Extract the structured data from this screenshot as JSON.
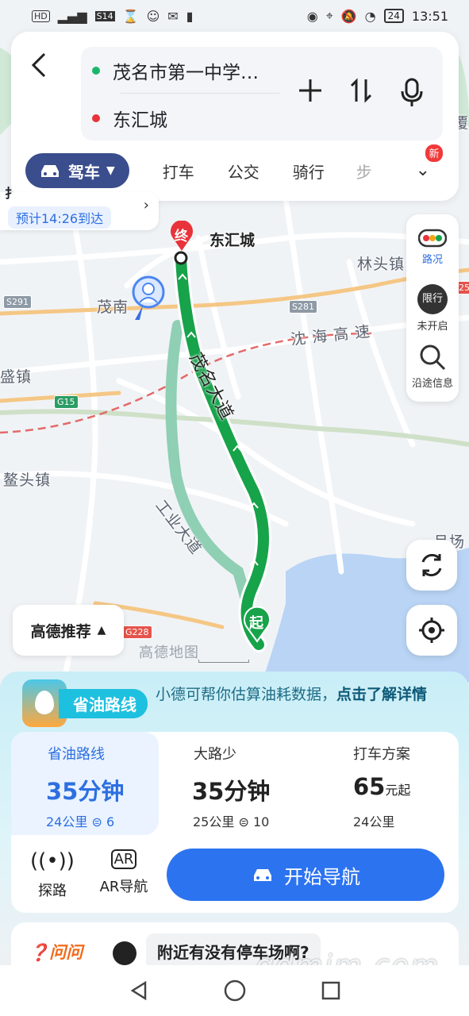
{
  "status_bar": {
    "left_icons": [
      "hd-icon",
      "4g-signal-icon",
      "s14-icon",
      "hourglass-icon",
      "profile-icon",
      "wechat-icon",
      "sim-icon"
    ],
    "network": "HD",
    "carrier_tag": "S14",
    "battery": "24",
    "time": "13:51"
  },
  "search": {
    "origin": "茂名市第一中学…",
    "destination": "东汇城",
    "origin_color": "#1bb66b",
    "destination_color": "#e8333a"
  },
  "mode_tabs": [
    {
      "label": "驾车",
      "active": true
    },
    {
      "label": "打车",
      "active": false
    },
    {
      "label": "公交",
      "active": false
    },
    {
      "label": "骑行",
      "active": false
    },
    {
      "label": "步",
      "active": false
    }
  ],
  "new_badge": "新",
  "eta": {
    "text": "预计14:26到达",
    "left_fragment": "扌"
  },
  "map": {
    "labels": {
      "end_pin": "终",
      "start_pin": "起",
      "destination": "东汇城",
      "linshan": "林头镇",
      "maonan": "茂南",
      "expressway": "沈 海 高 速",
      "shengzhen": "盛镇",
      "aotou": "鳌头镇",
      "maoming_ave": "茂名大道",
      "industry_ave": "工业大道",
      "right_edge_top": "覆",
      "right_edge_mid": "月场"
    },
    "road_tags": [
      "S291",
      "S281",
      "G15",
      "G228",
      "S14",
      "25"
    ],
    "route_color": "#17a34a",
    "alt_route_color": "#8fcfb4"
  },
  "tools": {
    "traffic": "路况",
    "restriction_badge": "限行",
    "restriction": "未开启",
    "along_route": "沿途信息"
  },
  "recommend": {
    "label": "高德推荐"
  },
  "watermark": "高德地图",
  "promo": {
    "tag": "省油路线",
    "text": "小德可帮你估算油耗数据，",
    "link": "点击了解详情"
  },
  "routes": [
    {
      "name": "省油路线",
      "time": "35分钟",
      "distance": "24公里",
      "lights": "6",
      "selected": true
    },
    {
      "name": "大路少",
      "time": "35分钟",
      "distance": "25公里",
      "lights": "10",
      "selected": false
    },
    {
      "name": "打车方案",
      "time": "65",
      "time_unit": "元起",
      "distance": "24公里",
      "selected": false
    }
  ],
  "actions": {
    "explore": "探路",
    "ar_nav": "AR导航",
    "start": "开始导航"
  },
  "ask": {
    "tag": "问问",
    "question": "附近有没有停车场啊?"
  },
  "site_watermark": "gdmim.com"
}
